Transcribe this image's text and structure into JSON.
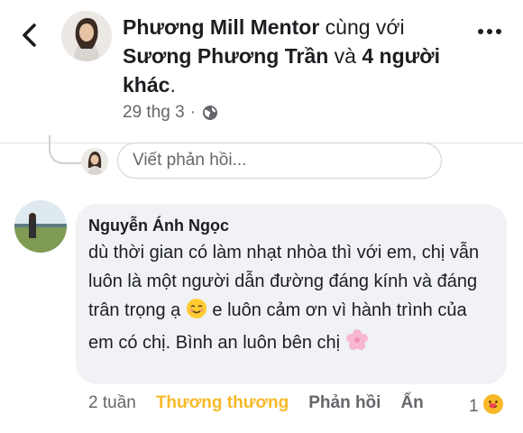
{
  "header": {
    "author": "Phương Mill Mentor",
    "with_text": " cùng với",
    "tagged": "Sương Phương Trần",
    "and_text": " và ",
    "others": "4 người khác",
    "period": "."
  },
  "meta": {
    "date": "29 thg 3",
    "dot": "·"
  },
  "reply": {
    "placeholder": "Viết phản hồi..."
  },
  "comment": {
    "name": "Nguyễn Ánh Ngọc",
    "text_part1": "dù thời gian có làm nhạt nhòa thì với em, chị vẫn luôn là một người dẫn đường đáng kính và đáng trân trọng ạ ",
    "text_part2": "  e luôn cảm ơn vì hành trình của em có chị. Bình an luôn bên chị ",
    "age": "2 tuần",
    "reaction_label": "Thương thương",
    "reply_label": "Phản hồi",
    "hide_label": "Ẩn",
    "reaction_count": "1"
  },
  "icons": {
    "back": "chevron-left-icon",
    "more": "more-horizontal-icon",
    "globe": "globe-icon",
    "smile": "smiling-face-emoji",
    "flower": "cherry-blossom-emoji",
    "care": "care-reaction-icon"
  },
  "colors": {
    "loved": "#f7b928",
    "bubble": "#f0f2f5",
    "muted": "#65676b"
  }
}
